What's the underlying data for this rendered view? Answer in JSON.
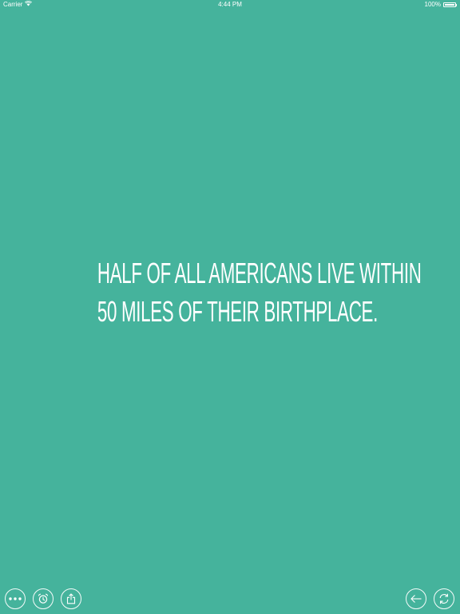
{
  "status_bar": {
    "carrier": "Carrier",
    "time": "4:44 PM",
    "battery": "100%"
  },
  "fact": {
    "line1": "Half of all Americans live within",
    "line2": "50 miles of their birthplace."
  },
  "toolbar": {
    "left_icons": [
      "more-icon",
      "alarm-icon",
      "share-icon"
    ],
    "right_icons": [
      "back-arrow-icon",
      "refresh-icon"
    ]
  },
  "colors": {
    "background": "#45b39c",
    "foreground": "#ffffff"
  }
}
